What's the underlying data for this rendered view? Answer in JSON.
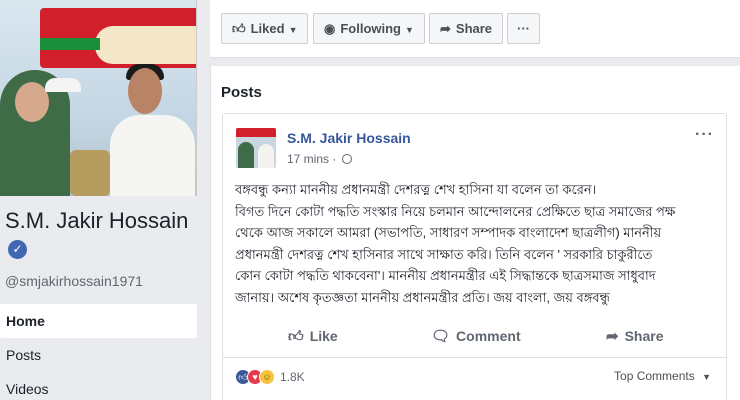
{
  "page": {
    "name": "S.M. Jakir Hossain",
    "handle": "@smjakirhossain1971"
  },
  "nav": [
    {
      "label": "Home",
      "active": true
    },
    {
      "label": "Posts",
      "active": false
    },
    {
      "label": "Videos",
      "active": false
    }
  ],
  "action_bar": {
    "liked": "Liked",
    "following": "Following",
    "share": "Share",
    "more": "···"
  },
  "posts_heading": "Posts",
  "post": {
    "author": "S.M. Jakir Hossain",
    "time": "17 mins",
    "menu": "···",
    "text_lines": [
      "বঙ্গবন্ধু কন্যা মাননীয় প্রধানমন্ত্রী দেশরত্ন শেখ হাসিনা যা বলেন তা করেন।",
      "বিগত দিনে কোটা পদ্ধতি সংস্কার নিয়ে চলমান আন্দোলনের প্রেক্ষিতে ছাত্র সমাজের পক্ষ",
      "থেকে আজ সকালে আমরা (সভাপতি, সাধারণ সম্পাদক বাংলাদেশ ছাত্রলীগ) মাননীয়",
      "প্রধানমন্ত্রী দেশরত্ন শেখ হাসিনার সাথে সাক্ষাত করি। তিনি বলেন ' সরকারি চাকুরীতে",
      "কোন কোটা পদ্ধতি থাকবেনা'। মাননীয় প্রধানমন্ত্রীর এই সিদ্ধান্তকে ছাত্রসমাজ সাধুবাদ",
      "জানায়। অশেষ কৃতজ্ঞতা মাননীয় প্রধানমন্ত্রীর প্রতি। জয় বাংলা, জয় বঙ্গবন্ধু"
    ],
    "like_label": "Like",
    "comment_label": "Comment",
    "share_label": "Share",
    "reaction_count": "1.8K",
    "top_comments": "Top Comments"
  },
  "colors": {
    "brand_blue": "#4267b2",
    "link_blue": "#365899",
    "background": "#e9ebee"
  },
  "icons": [
    "thumbs-up-icon",
    "rss-icon",
    "share-arrow-icon",
    "comment-bubble-icon",
    "globe-icon",
    "verified-badge-icon"
  ]
}
